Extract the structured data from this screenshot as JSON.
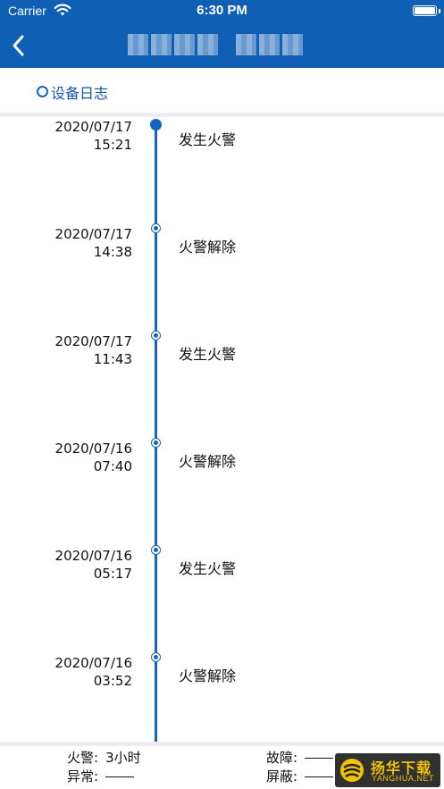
{
  "status_bar": {
    "carrier": "Carrier",
    "time": "6:30 PM",
    "battery_level": 1.0
  },
  "nav_bar": {
    "back_icon": "chevron-left-icon",
    "background_color": "#0f5fb4"
  },
  "section": {
    "title": "设备日志"
  },
  "timeline": {
    "accent_color": "#1565c0",
    "entries": [
      {
        "date": "2020/07/17",
        "time": "15:21",
        "event": "发生火警"
      },
      {
        "date": "2020/07/17",
        "time": "14:38",
        "event": "火警解除"
      },
      {
        "date": "2020/07/17",
        "time": "11:43",
        "event": "发生火警"
      },
      {
        "date": "2020/07/16",
        "time": "07:40",
        "event": "火警解除"
      },
      {
        "date": "2020/07/16",
        "time": "05:17",
        "event": "发生火警"
      },
      {
        "date": "2020/07/16",
        "time": "03:52",
        "event": "火警解除"
      }
    ]
  },
  "summary": {
    "fire_label": "火警:",
    "fire_value": "3小时",
    "fault_label": "故障:",
    "abnormal_label": "异常:",
    "shield_label": "屏蔽:"
  },
  "watermark": {
    "name": "扬华下载",
    "domain": "YANGHUA.NET"
  }
}
